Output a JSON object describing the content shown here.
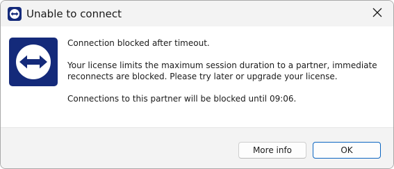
{
  "window": {
    "title": "Unable to connect",
    "icon": "teamviewer-logo-icon",
    "close_icon": "close-icon"
  },
  "message": {
    "line1": "Connection blocked after timeout.",
    "line2": "Your license limits the maximum session duration to a partner, immediate reconnects are blocked. Please try later or upgrade your license.",
    "line3": "Connections to this partner will be blocked until 09:06."
  },
  "buttons": {
    "more_info": "More info",
    "ok": "OK"
  },
  "colors": {
    "brand": "#142a7a",
    "accent": "#0a64c0"
  }
}
